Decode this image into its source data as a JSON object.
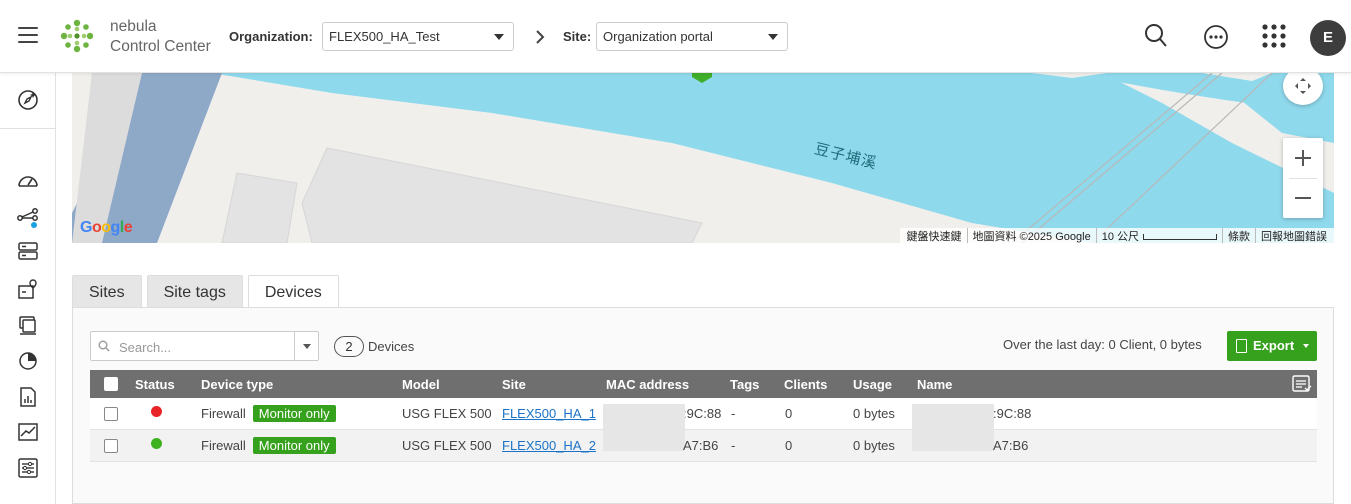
{
  "brand": {
    "line1": "nebula",
    "line2": "Control Center"
  },
  "header": {
    "org_label": "Organization:",
    "org_value": "FLEX500_HA_Test",
    "site_label": "Site:",
    "site_value": "Organization portal",
    "avatar_initial": "E"
  },
  "map": {
    "water_label": "豆子埔溪",
    "google": [
      "G",
      "o",
      "o",
      "g",
      "l",
      "e"
    ],
    "footer": [
      "鍵盤快速鍵",
      "地圖資料 ©2025 Google",
      "10 公尺",
      "條款",
      "回報地圖錯誤"
    ]
  },
  "tabs": [
    "Sites",
    "Site tags",
    "Devices"
  ],
  "devices": {
    "search_placeholder": "Search...",
    "count": "2",
    "count_label": "Devices",
    "summary": "Over the last day: 0 Client, 0 bytes",
    "export_label": "Export",
    "columns": [
      "Status",
      "Device type",
      "Model",
      "Site",
      "MAC address",
      "Tags",
      "Clients",
      "Usage",
      "Name"
    ],
    "rows": [
      {
        "status_color": "#e8262a",
        "type": "Firewall",
        "badge": "Monitor only",
        "model": "USG FLEX 500",
        "site": "FLEX500_HA_1",
        "mac": ":9C:88",
        "tags": "-",
        "clients": "0",
        "usage": "0 bytes",
        "name": ":9C:88"
      },
      {
        "status_color": "#3eb11f",
        "type": "Firewall",
        "badge": "Monitor only",
        "model": "USG FLEX 500",
        "site": "FLEX500_HA_2",
        "mac": "A7:B6",
        "tags": "-",
        "clients": "0",
        "usage": "0 bytes",
        "name": "A7:B6"
      }
    ]
  },
  "colors": {
    "accent": "#35a11c",
    "water": "#8fd9ec",
    "header_row": "#6f6f6f"
  }
}
